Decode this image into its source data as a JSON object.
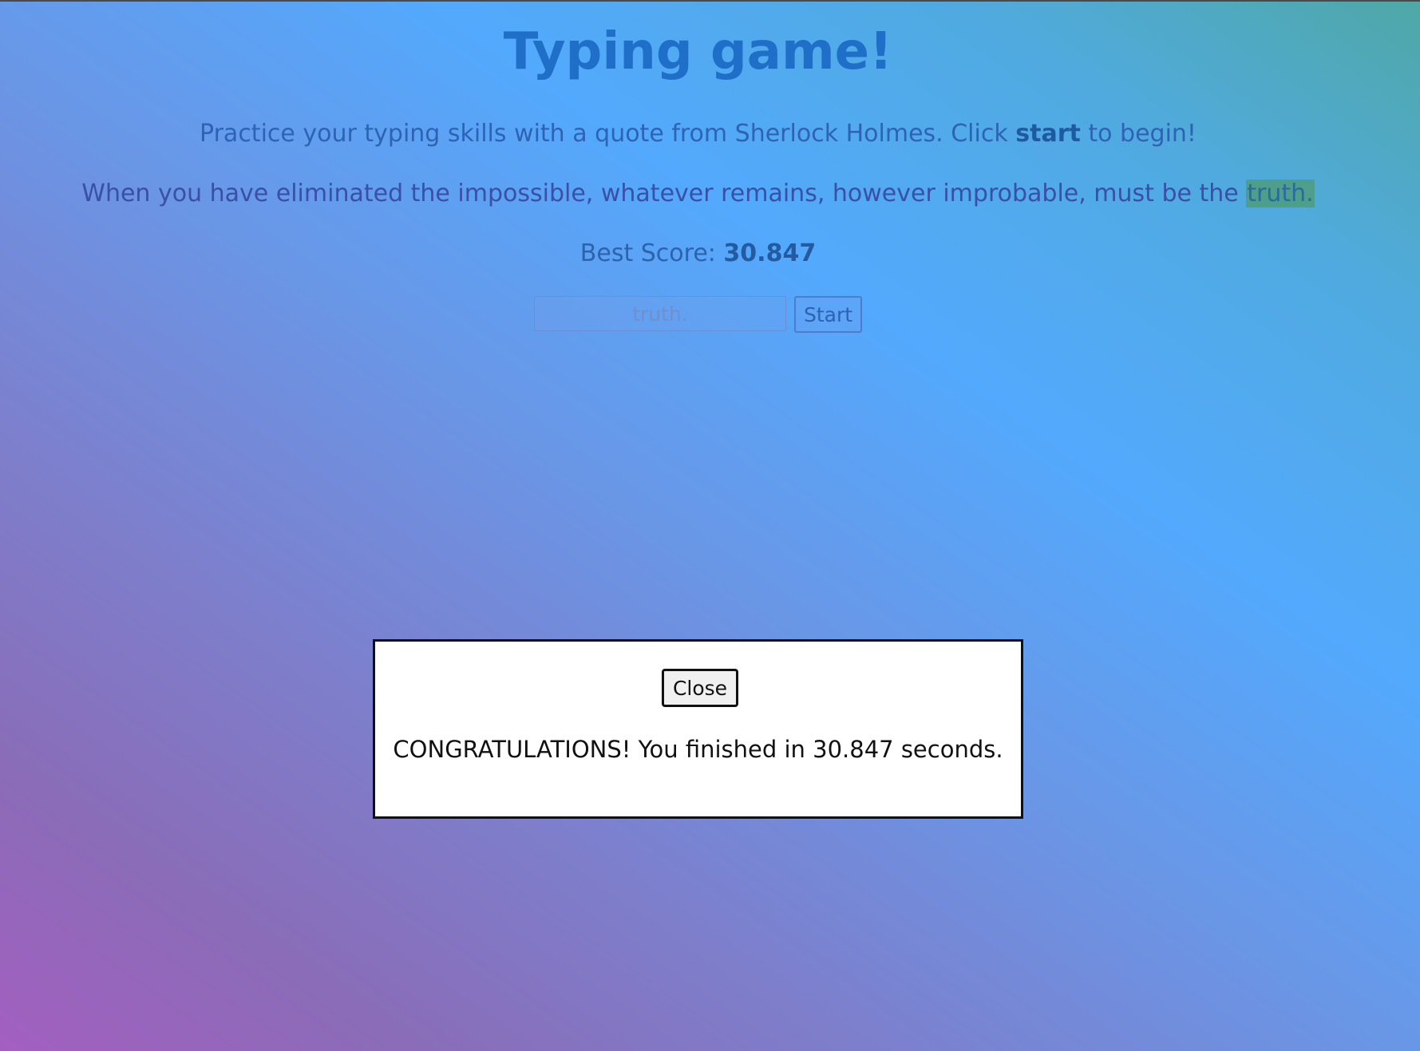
{
  "header": {
    "title": "Typing game!"
  },
  "intro": {
    "before": "Practice your typing skills with a quote from Sherlock Holmes. Click ",
    "bold": "start",
    "after": " to begin!"
  },
  "quote": {
    "text_before": "When you have eliminated the impossible, whatever remains, however improbable, must be the ",
    "highlighted_word": "truth."
  },
  "best_score": {
    "label": "Best Score: ",
    "value": "30.847"
  },
  "typing_input": {
    "value": "truth."
  },
  "start_button": {
    "label": "Start"
  },
  "modal": {
    "close_label": "Close",
    "message": "CONGRATULATIONS! You finished in 30.847 seconds."
  },
  "colors": {
    "title": "#1f6fc8",
    "highlight": "#4e9e8c",
    "modal_background": "#ffffff"
  }
}
